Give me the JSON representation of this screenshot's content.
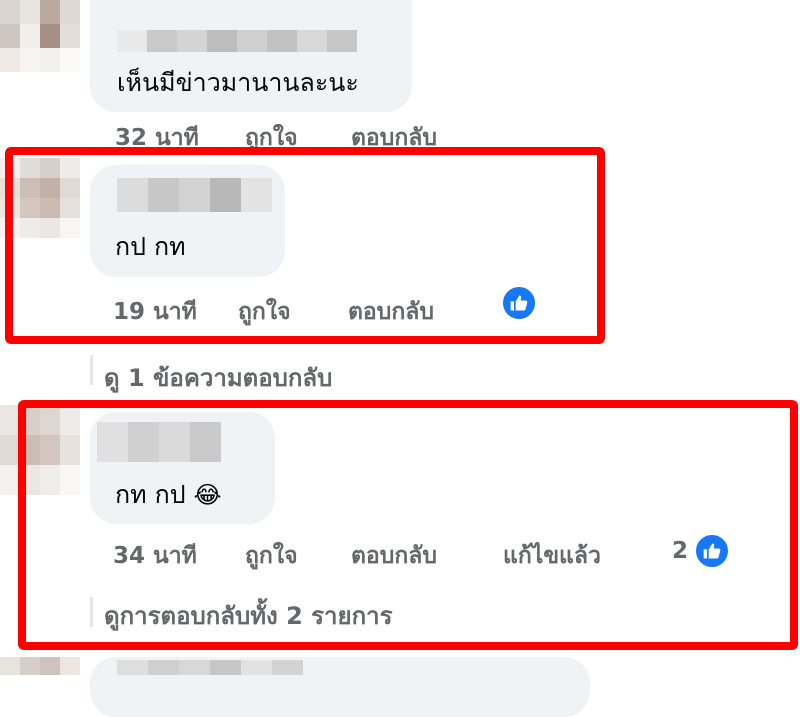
{
  "comments": [
    {
      "text": "เห็นมีข่าวมานานละนะ",
      "time": "32 นาที",
      "like": "ถูกใจ",
      "reply": "ตอบกลับ"
    },
    {
      "text": "กป กท",
      "time": "19 นาที",
      "like": "ถูกใจ",
      "reply": "ตอบกลับ",
      "reaction_icon": "like-icon",
      "view_replies": "ดู 1 ข้อความตอบกลับ"
    },
    {
      "text": "กท กป",
      "emoji": "😂",
      "time": "34 นาที",
      "like": "ถูกใจ",
      "reply": "ตอบกลับ",
      "edited": "แก้ไขแล้ว",
      "reaction_count": "2",
      "reaction_icon": "like-icon",
      "view_replies": "ดูการตอบกลับทั้ง 2 รายการ"
    }
  ],
  "colors": {
    "highlight": "#ff0000",
    "bubble": "#f0f2f5",
    "meta_text": "#65676b",
    "like_blue": "#1877f2"
  }
}
